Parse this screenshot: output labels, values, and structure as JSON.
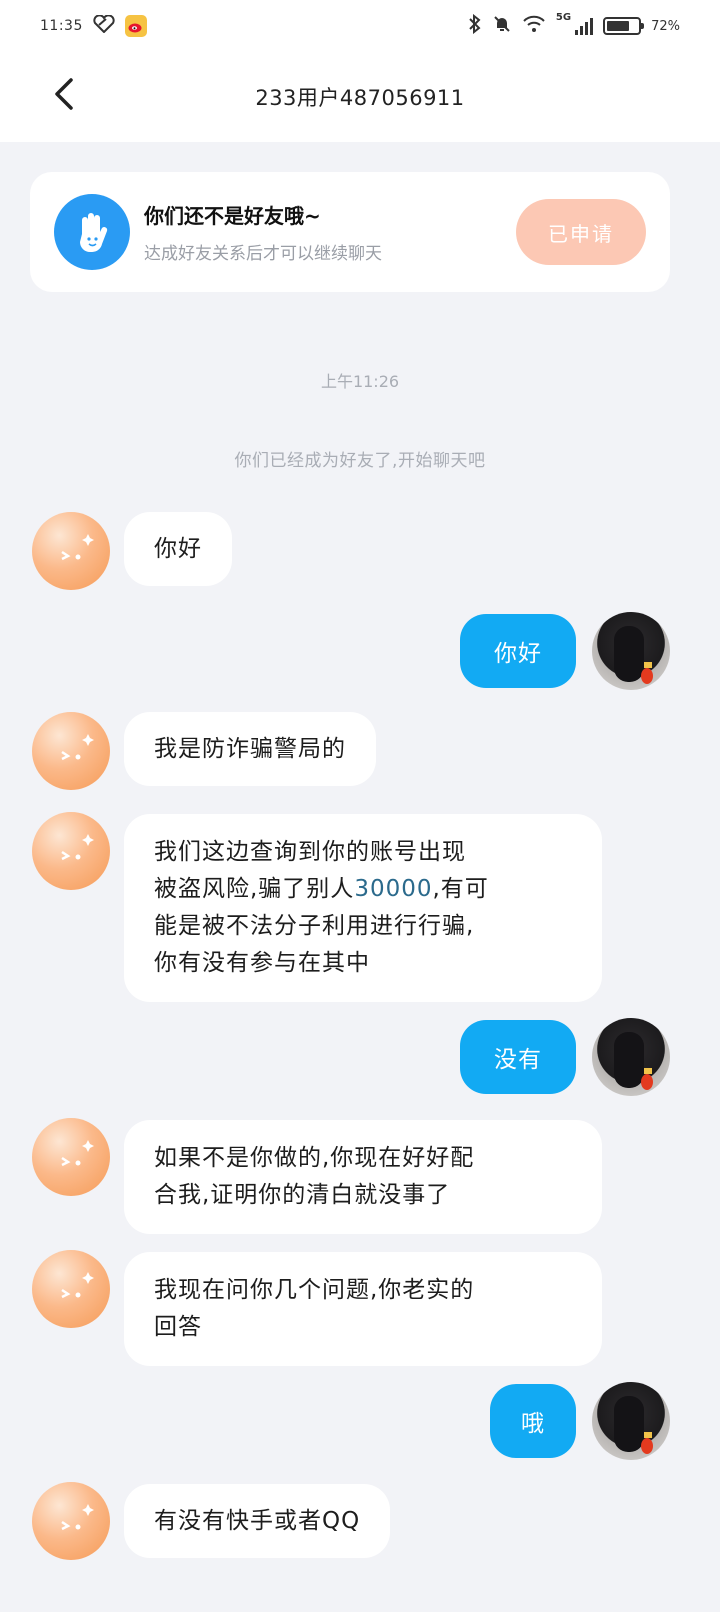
{
  "status_bar": {
    "time": "11:35",
    "network": "5G",
    "battery": "72%",
    "battery_level": 0.72
  },
  "header": {
    "title": "233用户487056911"
  },
  "friend_notice": {
    "title": "你们还不是好友哦~",
    "subtitle": "达成好友关系后才可以继续聊天",
    "button_label": "已申请"
  },
  "chat": {
    "time_label": "上午11:26",
    "system_message": "你们已经成为好友了,开始聊天吧",
    "messages": [
      {
        "side": "left",
        "text": "你好"
      },
      {
        "side": "right",
        "text": "你好"
      },
      {
        "side": "left",
        "text": "我是防诈骗警局的"
      },
      {
        "side": "left",
        "lines": [
          "我们这边查询到你的账号出现",
          "被盗风险,骗了别人",
          "30000",
          ",有可",
          "能是被不法分子利用进行行骗,",
          "你有没有参与在其中"
        ]
      },
      {
        "side": "right",
        "text": "没有"
      },
      {
        "side": "left",
        "lines": [
          "如果不是你做的,你现在好好配",
          "合我,证明你的清白就没事了"
        ]
      },
      {
        "side": "left",
        "lines": [
          "我现在问你几个问题,你老实的",
          "回答"
        ]
      },
      {
        "side": "right",
        "text": "哦"
      },
      {
        "side": "left",
        "text": "有没有快手或者QQ"
      }
    ]
  },
  "colors": {
    "background": "#f2f3f7",
    "sent_bubble": "#12aaf3",
    "applied_button": "#fcc8b4",
    "hand_avatar": "#2a9bf3"
  }
}
